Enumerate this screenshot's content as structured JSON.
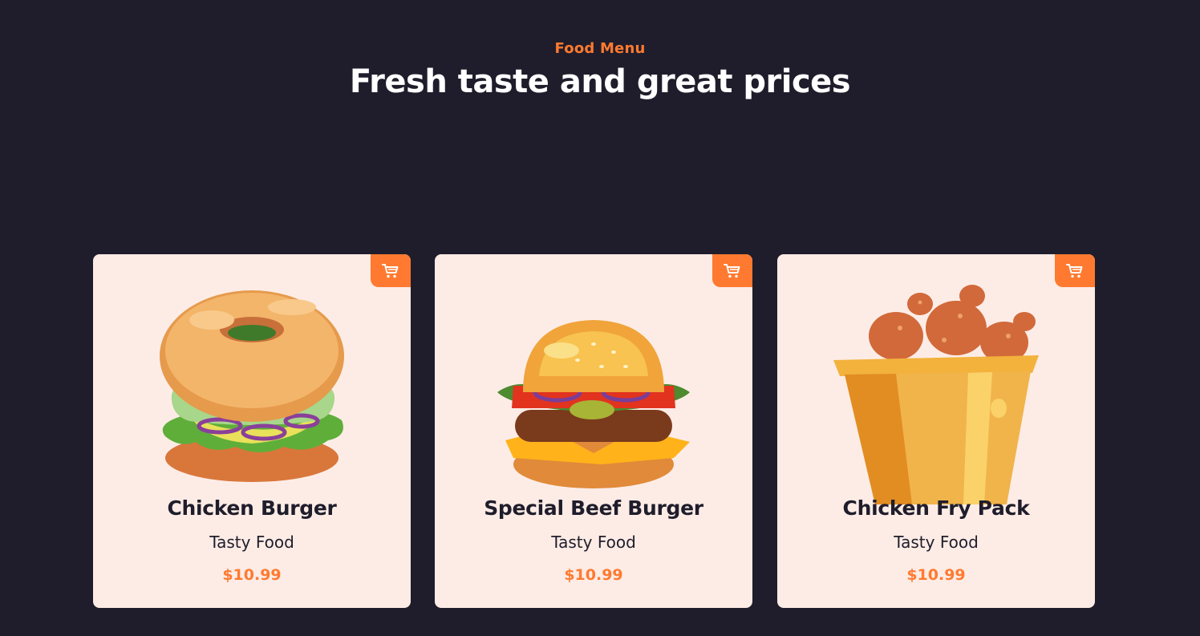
{
  "header": {
    "eyebrow": "Food Menu",
    "title": "Fresh taste and great prices"
  },
  "colors": {
    "background": "#1f1d2b",
    "accent": "#ff7a30",
    "card": "#fdece6"
  },
  "menu": [
    {
      "name": "Chicken Burger",
      "subtitle": "Tasty Food",
      "price": "$10.99",
      "image": "bagel-sandwich-illustration",
      "icon": "cart-icon"
    },
    {
      "name": "Special Beef Burger",
      "subtitle": "Tasty Food",
      "price": "$10.99",
      "image": "beef-burger-illustration",
      "icon": "cart-icon"
    },
    {
      "name": "Chicken Fry Pack",
      "subtitle": "Tasty Food",
      "price": "$10.99",
      "image": "fried-chicken-bucket-illustration",
      "icon": "cart-icon"
    }
  ]
}
